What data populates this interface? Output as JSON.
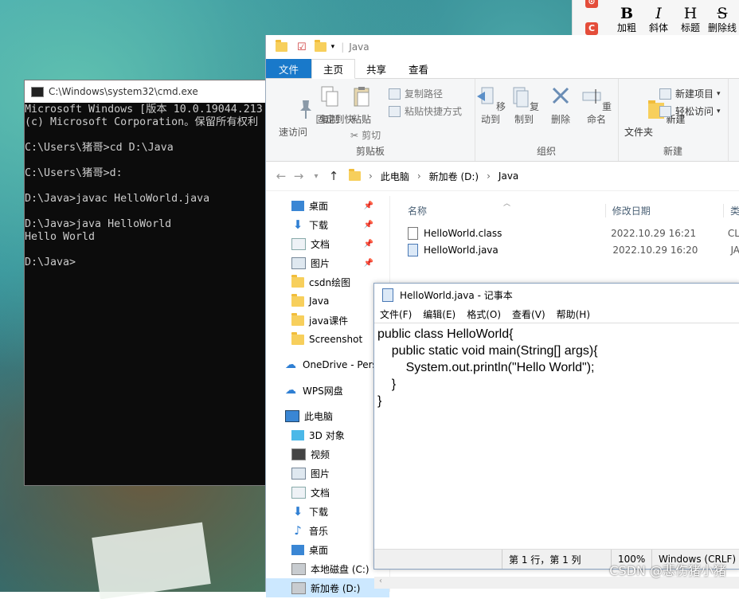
{
  "wps": {
    "labels": [
      "加粗",
      "斜体",
      "标题",
      "删除线"
    ],
    "glyphs": [
      "B",
      "I",
      "H",
      "S"
    ]
  },
  "cmd": {
    "title": "C:\\Windows\\system32\\cmd.exe",
    "lines": "Microsoft Windows [版本 10.0.19044.213\n(c) Microsoft Corporation。保留所有权利\n\nC:\\Users\\猪哥>cd D:\\Java\n\nC:\\Users\\猪哥>d:\n\nD:\\Java>javac HelloWorld.java\n\nD:\\Java>java HelloWorld\nHello World\n\nD:\\Java>"
  },
  "explorer": {
    "title": "Java",
    "tabs": [
      "文件",
      "主页",
      "共享",
      "查看"
    ],
    "ribbon": {
      "pin": "固定到快\n速访问",
      "copy": "复制",
      "paste": "粘贴",
      "copy_path": "复制路径",
      "paste_shortcut": "粘贴快捷方式",
      "cut": "剪切",
      "clipboard": "剪贴板",
      "move_to": "移动到",
      "copy_to": "复制到",
      "delete": "删除",
      "rename": "重命名",
      "organize": "组织",
      "new_folder": "新建\n文件夹",
      "new_item": "新建项目",
      "easy_access": "轻松访问",
      "new": "新建"
    },
    "crumbs": [
      "此电脑",
      "新加卷 (D:)",
      "Java"
    ],
    "sidebar": [
      "桌面",
      "下载",
      "文档",
      "图片",
      "csdn绘图",
      "Java",
      "java课件",
      "Screenshot",
      "OneDrive - Pers",
      "WPS网盘",
      "此电脑",
      "3D 对象",
      "视频",
      "图片",
      "文档",
      "下载",
      "音乐",
      "桌面",
      "本地磁盘 (C:)",
      "新加卷 (D:)"
    ],
    "columns": [
      "名称",
      "修改日期",
      "类"
    ],
    "files": [
      {
        "name": "HelloWorld.class",
        "date": "2022.10.29 16:21",
        "type": "CL"
      },
      {
        "name": "HelloWorld.java",
        "date": "2022.10.29 16:20",
        "type": "JA"
      }
    ]
  },
  "notepad": {
    "title": "HelloWorld.java - 记事本",
    "menu": [
      "文件(F)",
      "编辑(E)",
      "格式(O)",
      "查看(V)",
      "帮助(H)"
    ],
    "content": "public class HelloWorld{\n    public static void main(String[] args){\n        System.out.println(\"Hello World\");\n    }\n}",
    "status": {
      "pos": "第 1 行，第 1 列",
      "zoom": "100%",
      "eol": "Windows (CRLF)"
    }
  },
  "watermark": "CSDN @悲伤猪小猪"
}
